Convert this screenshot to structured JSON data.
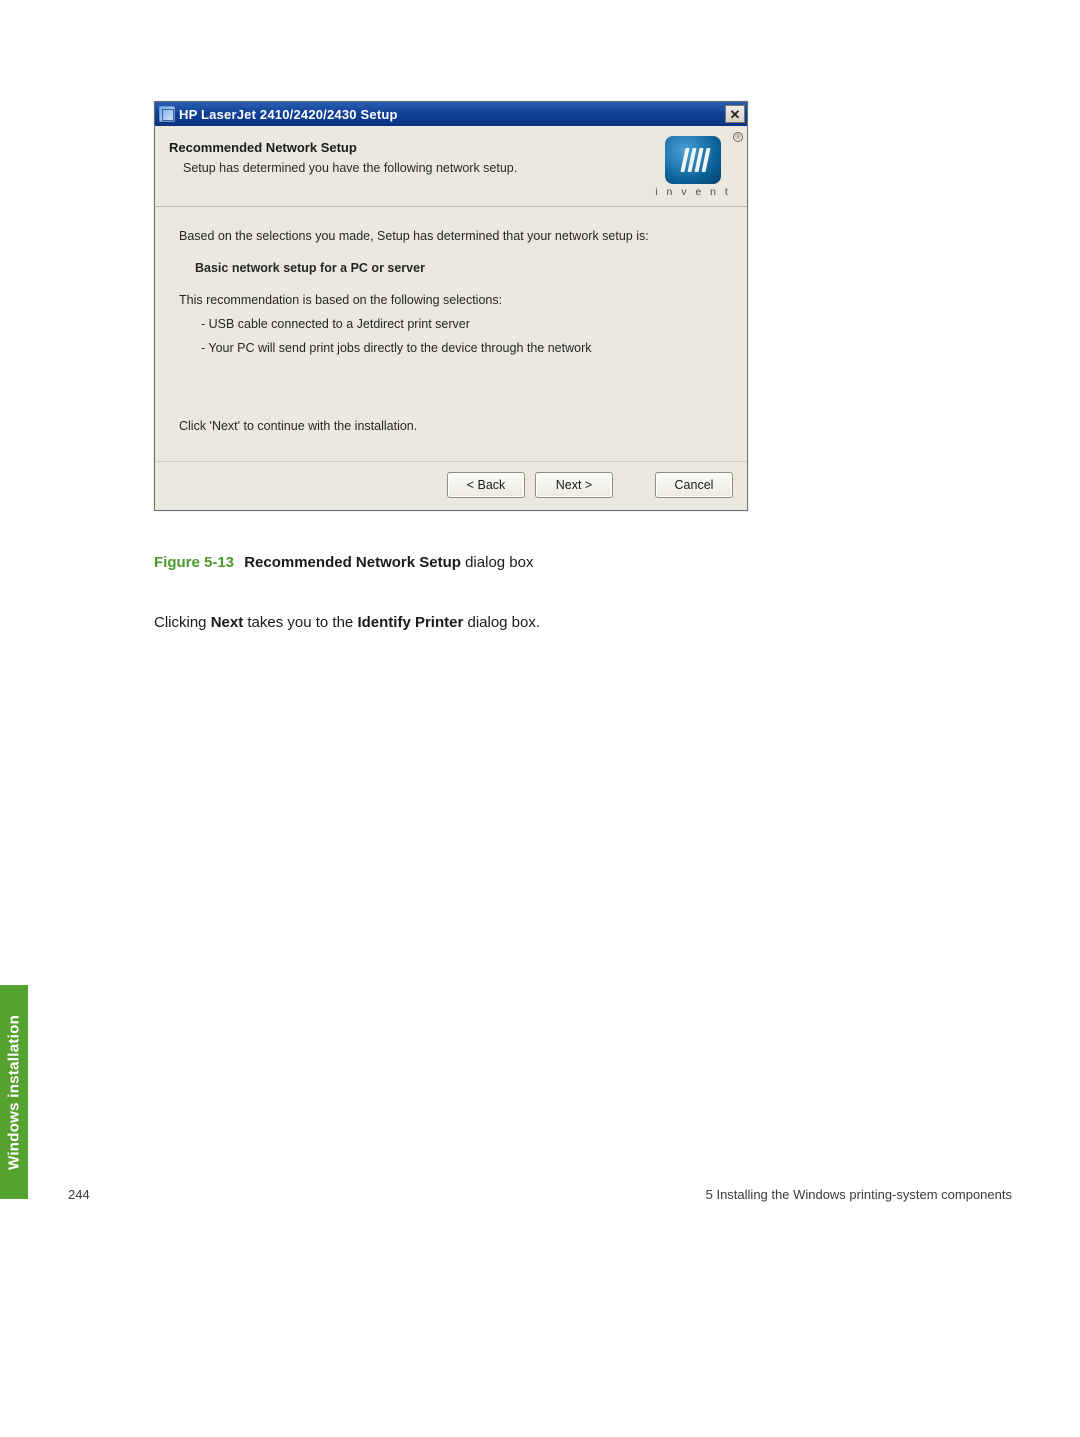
{
  "dialog": {
    "window_title": "HP LaserJet 2410/2420/2430 Setup",
    "close_glyph": "✕",
    "header_title": "Recommended Network Setup",
    "header_sub": "Setup has determined you have the following network setup.",
    "logo_sub": "i n v e n t",
    "reg_mark": "®",
    "intro": "Based on the selections you made, Setup has determined that your network setup is:",
    "basic": "Basic network setup for a PC or server",
    "rec_intro": "This recommendation is based on the following selections:",
    "selections": [
      "- USB cable connected to a Jetdirect print server",
      "- Your PC will send print jobs directly to the device through the network"
    ],
    "next_note": "Click 'Next' to continue with the installation.",
    "buttons": {
      "back": "< Back",
      "next": "Next >",
      "cancel": "Cancel"
    }
  },
  "figure": {
    "label": "Figure 5-13",
    "bold": "Recommended Network Setup",
    "tail": " dialog box"
  },
  "paragraph": {
    "pre": "Clicking ",
    "b1": "Next",
    "mid": " takes you to the ",
    "b2": "Identify Printer",
    "post": " dialog box."
  },
  "side_tab": "Windows installation",
  "footer": {
    "page_no": "244",
    "chapter": "5   Installing the Windows printing-system components"
  }
}
